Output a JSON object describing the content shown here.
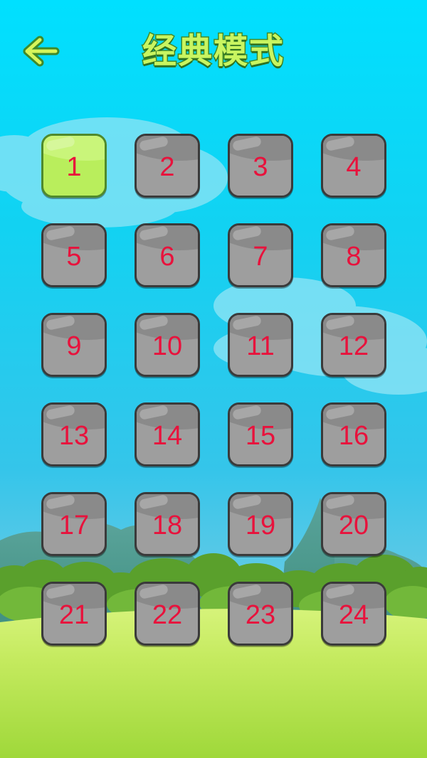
{
  "header": {
    "title": "经典模式",
    "back_icon": "arrow-left-icon"
  },
  "levels": [
    {
      "label": "1",
      "state": "unlocked"
    },
    {
      "label": "2",
      "state": "locked"
    },
    {
      "label": "3",
      "state": "locked"
    },
    {
      "label": "4",
      "state": "locked"
    },
    {
      "label": "5",
      "state": "locked"
    },
    {
      "label": "6",
      "state": "locked"
    },
    {
      "label": "7",
      "state": "locked"
    },
    {
      "label": "8",
      "state": "locked"
    },
    {
      "label": "9",
      "state": "locked"
    },
    {
      "label": "10",
      "state": "locked"
    },
    {
      "label": "11",
      "state": "locked"
    },
    {
      "label": "12",
      "state": "locked"
    },
    {
      "label": "13",
      "state": "locked"
    },
    {
      "label": "14",
      "state": "locked"
    },
    {
      "label": "15",
      "state": "locked"
    },
    {
      "label": "16",
      "state": "locked"
    },
    {
      "label": "17",
      "state": "locked"
    },
    {
      "label": "18",
      "state": "locked"
    },
    {
      "label": "19",
      "state": "locked"
    },
    {
      "label": "20",
      "state": "locked"
    },
    {
      "label": "21",
      "state": "locked"
    },
    {
      "label": "22",
      "state": "locked"
    },
    {
      "label": "23",
      "state": "locked"
    },
    {
      "label": "24",
      "state": "locked"
    }
  ],
  "colors": {
    "title_fill": "#c8f560",
    "title_stroke": "#3f8a2a",
    "locked_tile": "#9e9e9e",
    "unlocked_tile": "#b9ee5c",
    "level_number": "#e8123c",
    "sky_top": "#00e0ff",
    "grass": "#c4ea60"
  }
}
